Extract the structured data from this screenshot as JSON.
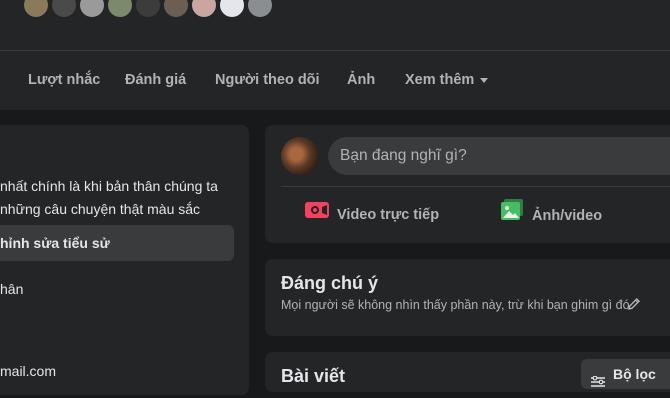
{
  "profile_tabs": [
    "Lượt nhắc",
    "Đánh giá",
    "Người theo dõi",
    "Ảnh",
    "Xem thêm"
  ],
  "friend_avatar_colors": [
    "#8a7a5a",
    "#4a4a4a",
    "#9a9a9a",
    "#7a8a6a",
    "#3c3c3c",
    "#6b5f55",
    "#c9a7a0",
    "#e4e6eb",
    "#8a8d91"
  ],
  "intro": {
    "bio_line1": "nhất chính là khi bản thân chúng ta",
    "bio_line2": "những câu chuyện thật màu sắc",
    "edit_bio_button": "hỉnh sửa tiểu sử",
    "detail1": "hân",
    "detail2": "mail.com"
  },
  "composer": {
    "placeholder": "Bạn đang nghĩ gì?",
    "live_label": "Video trực tiếp",
    "photo_label": "Ảnh/video"
  },
  "featured": {
    "title": "Đáng chú ý",
    "subtitle": "Mọi người sẽ không nhìn thấy phần này, trừ khi bạn ghim gì đó."
  },
  "posts": {
    "title": "Bài viết",
    "filter_label": "Bộ lọc"
  },
  "colors": {
    "live_red": "#f3425f",
    "photo_green": "#45bd62"
  }
}
